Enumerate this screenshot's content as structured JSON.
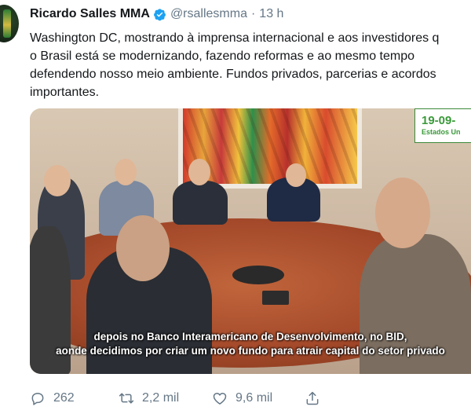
{
  "author": {
    "name": "Ricardo Salles MMA",
    "handle": "@rsallesmma",
    "separator": "·",
    "time": "13 h"
  },
  "tweet": {
    "text": "Washington DC, mostrando à imprensa internacional e aos investidores q\no Brasil está se modernizando, fazendo reformas e ao mesmo tempo\ndefendendo nosso meio ambiente. Fundos privados, parcerias e acordos\nimportantes."
  },
  "media": {
    "date_badge": "19-09-",
    "date_badge_sub": "Estados Un",
    "subtitle_line1": "depois no Banco Interamericano de Desenvolvimento, no BID,",
    "subtitle_line2": "aonde decidimos por criar um novo fundo para atrair capital do setor privado"
  },
  "actions": {
    "replies": "262",
    "retweets": "2,2 mil",
    "likes": "9,6 mil"
  },
  "colors": {
    "verified_blue": "#1da1f2",
    "muted_text": "#657786",
    "badge_green": "#3a9a3a"
  }
}
